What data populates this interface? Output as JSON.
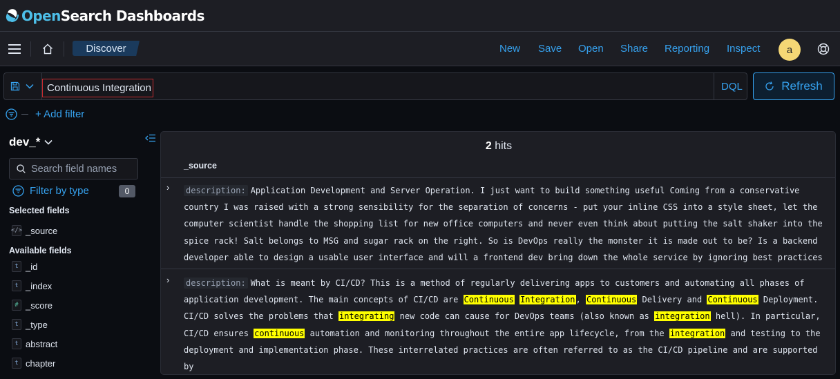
{
  "app": {
    "brand_open": "Open",
    "brand_search": "Search",
    "brand_rest": " Dashboards"
  },
  "nav": {
    "breadcrumb": "Discover",
    "links": [
      "New",
      "Save",
      "Open",
      "Share",
      "Reporting",
      "Inspect"
    ],
    "avatar_initial": "a"
  },
  "query": {
    "value": "Continuous Integration",
    "language": "DQL",
    "refresh_label": "Refresh"
  },
  "filters": {
    "add_filter_label": "+ Add filter"
  },
  "sidebar": {
    "index_pattern": "dev_*",
    "search_placeholder": "Search field names",
    "filter_by_type": "Filter by type",
    "filter_count": "0",
    "selected_title": "Selected fields",
    "selected_fields": [
      {
        "name": "_source",
        "type": "source"
      }
    ],
    "available_title": "Available fields",
    "available_fields": [
      {
        "name": "_id",
        "type": "t"
      },
      {
        "name": "_index",
        "type": "t"
      },
      {
        "name": "_score",
        "type": "#"
      },
      {
        "name": "_type",
        "type": "t"
      },
      {
        "name": "abstract",
        "type": "t"
      },
      {
        "name": "chapter",
        "type": "t"
      }
    ]
  },
  "results": {
    "hits_count": "2",
    "hits_label": " hits",
    "column": "_source",
    "documents": [
      {
        "key": "description:",
        "text": "Application Development and Server Operation. I just want to build something useful Coming from a conservative country I was raised with a strong sensibility for the separation of concerns - put your inline CSS into a style sheet, let the computer scientist handle the shopping list for new office computers and never even think about putting the salt shaker into the spice rack! Salt belongs to MSG and sugar rack on the right. So is DevOps really the monster it is made out to be? Is a backend developer able to design a usable user interface and will a frontend dev bring down the whole service by ignoring best practices of"
      },
      {
        "key": "description:",
        "segments": [
          {
            "t": "What is meant by CI/CD? This is a method of regularly delivering apps to customers and automating all phases of application development. The main concepts of CI/CD are ",
            "h": false
          },
          {
            "t": "Continuous",
            "h": true
          },
          {
            "t": " ",
            "h": false
          },
          {
            "t": "Integration",
            "h": true
          },
          {
            "t": ", ",
            "h": false
          },
          {
            "t": "Continuous",
            "h": true
          },
          {
            "t": " Delivery and ",
            "h": false
          },
          {
            "t": "Continuous",
            "h": true
          },
          {
            "t": " Deployment. CI/CD solves the problems that ",
            "h": false
          },
          {
            "t": "integrating",
            "h": true
          },
          {
            "t": " new code can cause for DevOps teams (also known as ",
            "h": false
          },
          {
            "t": "integration",
            "h": true
          },
          {
            "t": " hell). In particular, CI/CD ensures ",
            "h": false
          },
          {
            "t": "continuous",
            "h": true
          },
          {
            "t": " automation and monitoring throughout the entire app lifecycle, from the ",
            "h": false
          },
          {
            "t": "integration",
            "h": true
          },
          {
            "t": " and testing to the deployment and implementation phase. These interrelated practices are often referred to as the CI/CD pipeline and are supported by",
            "h": false
          }
        ]
      }
    ]
  },
  "colors": {
    "accent": "#36a2ef",
    "highlight": "#ffff00",
    "avatar": "#f5d775"
  }
}
